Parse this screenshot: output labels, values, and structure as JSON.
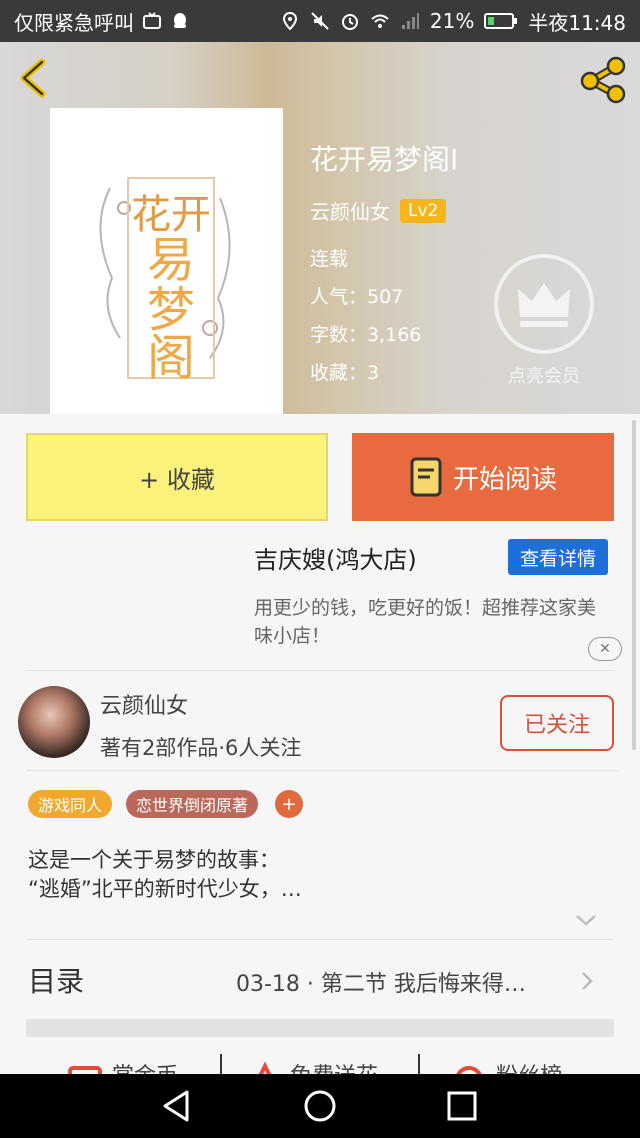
{
  "status_bar": {
    "carrier": "仅限紧急呼叫",
    "battery": "21%",
    "time": "半夜11:48"
  },
  "book": {
    "title": "花开易梦阁Ⅰ",
    "cover_text": "花开易梦阁",
    "author": "云颜仙女",
    "author_level": "Lv2",
    "status": "连载",
    "popularity": "人气：507",
    "word_count": "字数：3,166",
    "favorites": "收藏：3"
  },
  "vip": {
    "label": "点亮会员"
  },
  "actions": {
    "collect": "+ 收藏",
    "read": "开始阅读"
  },
  "ad": {
    "title": "吉庆嫂(鸿大店)",
    "button": "查看详情",
    "description": "用更少的钱，吃更好的饭！超推荐这家美味小店！",
    "close": "✕"
  },
  "author_card": {
    "name": "云颜仙女",
    "stats": "著有2部作品·6人关注",
    "follow_button": "已关注"
  },
  "tags": [
    {
      "label": "游戏同人",
      "color": "#f0a92e"
    },
    {
      "label": "恋世界倒闭原著",
      "color": "#b9685a"
    }
  ],
  "tag_add": "+",
  "description": {
    "line1": "这是一个关于易梦的故事：",
    "line2": "“逃婚”北平的新时代少女，…"
  },
  "catalog": {
    "label": "目录",
    "latest": "03-18 · 第二节 我后悔来得…"
  },
  "bottom_actions": [
    {
      "label": "赏金币"
    },
    {
      "label": "免费送花"
    },
    {
      "label": "粉丝榜"
    }
  ],
  "colors": {
    "accent_orange": "#e96a3e",
    "collect_yellow": "#faf27a",
    "ad_blue": "#1e6fd9",
    "follow_red": "#d8503a",
    "level_gold": "#f6b51b"
  }
}
